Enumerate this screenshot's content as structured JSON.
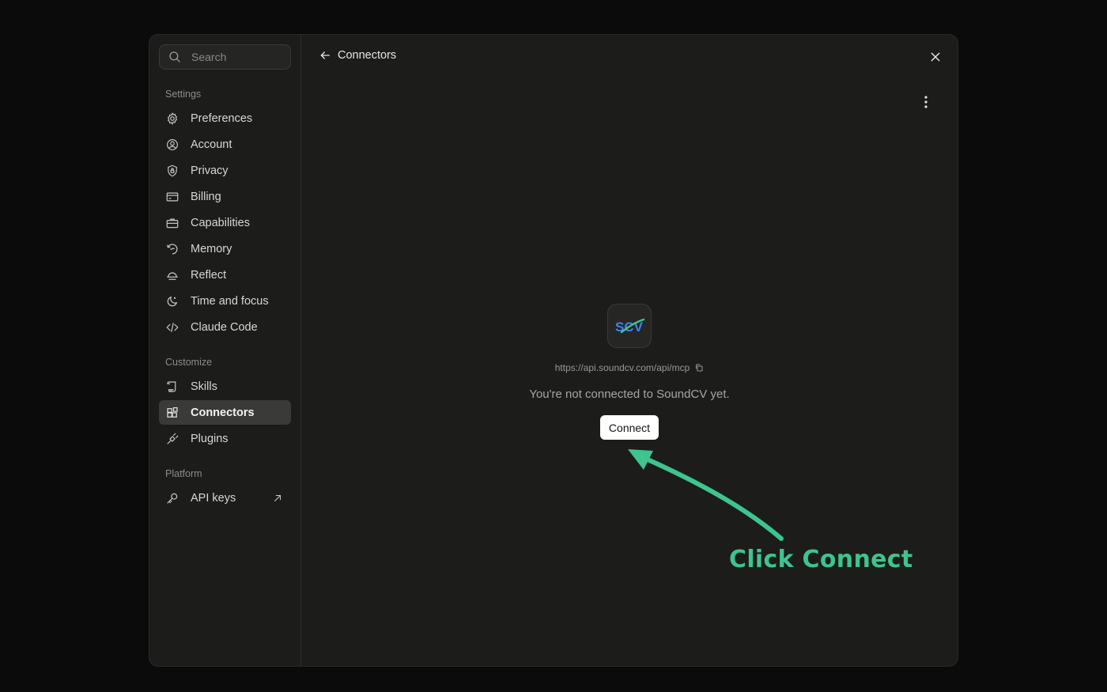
{
  "search": {
    "placeholder": "Search"
  },
  "sections": {
    "settings": {
      "label": "Settings",
      "items": [
        "Preferences",
        "Account",
        "Privacy",
        "Billing",
        "Capabilities",
        "Memory",
        "Reflect",
        "Time and focus",
        "Claude Code"
      ]
    },
    "customize": {
      "label": "Customize",
      "items": [
        "Skills",
        "Connectors",
        "Plugins"
      ]
    },
    "platform": {
      "label": "Platform",
      "items": [
        "API keys"
      ]
    }
  },
  "active_item": "Connectors",
  "header": {
    "title": "Connectors"
  },
  "connector": {
    "logo_text": "SCV",
    "url": "https://api.soundcv.com/api/mcp",
    "status": "You're not connected to SoundCV yet.",
    "connect_label": "Connect"
  },
  "annotation": {
    "text": "Click Connect",
    "color": "#3ec48f"
  },
  "colors": {
    "accent_annotation": "#3ec48f",
    "active_item_bg": "#3a3a38",
    "modal_bg": "#1c1c1b"
  }
}
